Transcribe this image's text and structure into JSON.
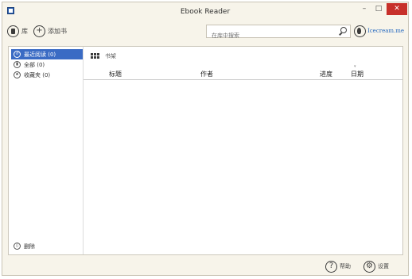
{
  "window": {
    "title": "Ebook Reader",
    "minimize": "–",
    "maximize": "□",
    "close": "✕"
  },
  "toolbar": {
    "library_label": "库",
    "add_book_label": "添加书",
    "search_placeholder": "在库中搜索",
    "brand": "Icecream.me"
  },
  "sidebar": {
    "items": [
      {
        "label": "最近阅读 (0)",
        "icon": "recent-icon",
        "active": true
      },
      {
        "label": "全部 (0)",
        "icon": "all-books-icon",
        "active": false
      },
      {
        "label": "收藏夹 (0)",
        "icon": "favorites-icon",
        "active": false
      }
    ],
    "delete_label": "删除"
  },
  "content": {
    "shelf_label": "书架",
    "columns": [
      "标题",
      "作者",
      "进度",
      "日期"
    ]
  },
  "bottombar": {
    "help_label": "帮助",
    "settings_label": "设置"
  },
  "colors": {
    "accent": "#3a6bc4",
    "window_bg": "#f7f4ea",
    "close_red": "#c7302b",
    "brand_blue": "#2a6cc0"
  }
}
